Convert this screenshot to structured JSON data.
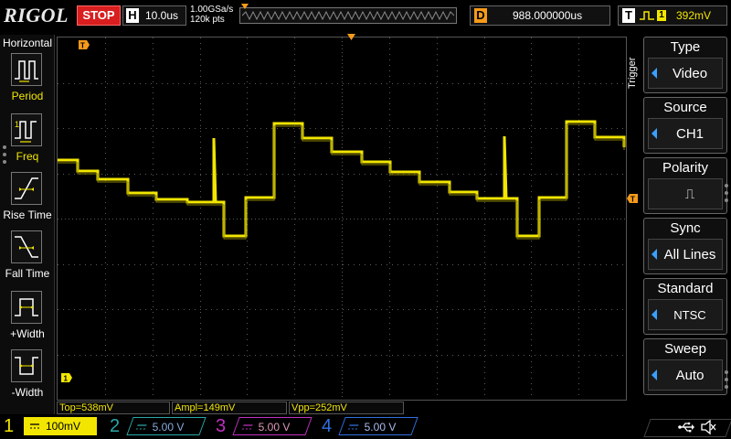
{
  "top": {
    "brand": "RIGOL",
    "run_state": "STOP",
    "timebase_letter": "H",
    "timebase": "10.0us",
    "sample_rate": "1.00GSa/s",
    "mem_depth": "120k pts",
    "delay_letter": "D",
    "delay": "988.000000us",
    "trigger_letter": "T",
    "trigger_source": "1",
    "trigger_level": "392mV"
  },
  "left_menu": {
    "title": "Horizontal",
    "items": [
      {
        "label": "Period",
        "icon": "period-icon"
      },
      {
        "label": "Freq",
        "icon": "freq-icon"
      },
      {
        "label": "Rise Time",
        "icon": "rise-time-icon"
      },
      {
        "label": "Fall Time",
        "icon": "fall-time-icon"
      },
      {
        "label": "+Width",
        "icon": "pos-width-icon"
      },
      {
        "label": "-Width",
        "icon": "neg-width-icon"
      }
    ]
  },
  "right_menu": {
    "title": "Trigger",
    "items": [
      {
        "header": "Type",
        "value": "Video"
      },
      {
        "header": "Source",
        "value": "CH1"
      },
      {
        "header": "Polarity",
        "value": "⎍"
      },
      {
        "header": "Sync",
        "value": "All Lines"
      },
      {
        "header": "Standard",
        "value": "NTSC"
      },
      {
        "header": "Sweep",
        "value": "Auto"
      }
    ]
  },
  "markers": {
    "t": "T",
    "ch1_ground": "1"
  },
  "measurements": {
    "top": "Top=538mV",
    "ampl": "Ampl=149mV",
    "vpp": "Vpp=252mV"
  },
  "channels": [
    {
      "num": "1",
      "scale": "100mV",
      "color": "#f2e600"
    },
    {
      "num": "2",
      "scale": "5.00 V",
      "color": "#2aa8a8"
    },
    {
      "num": "3",
      "scale": "5.00 V",
      "color": "#c030c0"
    },
    {
      "num": "4",
      "scale": "5.00 V",
      "color": "#3070e0"
    }
  ],
  "colors": {
    "ch1": "#f2e600",
    "grid": "#5a5a5a",
    "stop": "#d81e1e",
    "delay": "#f59a1a",
    "menu_arrow": "#3aa0ff"
  }
}
